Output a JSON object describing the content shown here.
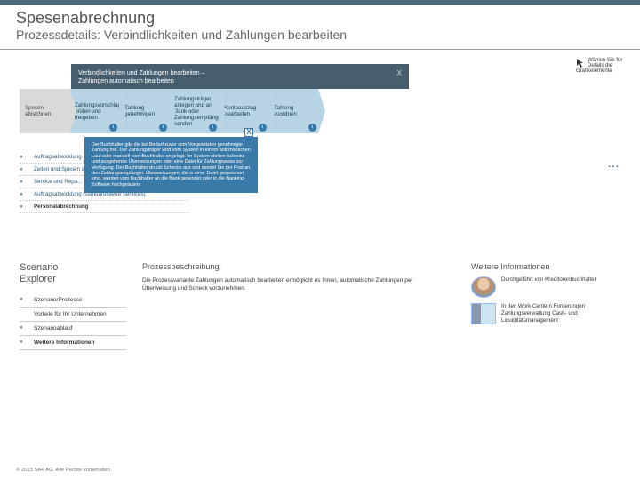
{
  "header": {
    "title": "Spesenabrechnung",
    "subtitle": "Prozessdetails: Verbindlichkeiten und Zahlungen bearbeiten"
  },
  "hint": "Wählen Sie für Details die Grafikelemente",
  "flow": {
    "panel_title_l1": "Verbindlichkeiten und Zahlungen bearbeiten –",
    "panel_title_l2": "Zahlungen automatisch bearbeiten",
    "close": "X",
    "steps": [
      "Spesen abrechnen",
      "Zahlungsvorschlag prüfen und freigeben",
      "Zahlung genehmigen",
      "Zahlungsträger anlegen und an Bank oder Zahlungsempfänger senden",
      "Kontoauszug bearbeiten",
      "Zahlung zuordnen"
    ]
  },
  "tooltip": {
    "close": "X",
    "text": "Der Buchhalter gibt die bei Bedarf zuvor vom Vorgesetzten genehmigte Zahlung frei. Der Zahlungsträger wird vom System in einem automatischen Lauf oder manuell vom Buchhalter angelegt. Im System stehen Schecks und ausgehende Überweisungen oder eine Datei für Zahlungsavise zur Verfügung. Der Buchhalter druckt Schecks aus und sendet Sie per Post an den Zahlungsempfänger. Überweisungen, die in einer Datei gespeichert sind, werden vom Buchhalter an die Bank gesendet oder in die Banking-Software hochgeladen."
  },
  "side_items": [
    "Auftragsabwicklung",
    "Zeiten und Spesen an Unternehmen über...",
    "Service und Repa...",
    "Auftragsabwicklung (standardisierte Services)",
    "Personalabrechnung"
  ],
  "ellipsis": "…",
  "explorer": {
    "l1": "Scenario",
    "l2": "Explorer"
  },
  "left_nav": [
    "Szenario/Prozesse",
    "Vorteile für Ihr Unternehmen",
    "Szenarioablauf",
    "Weitere Informationen"
  ],
  "description": {
    "heading": "Prozessbeschreibung:",
    "text": "Die Prozessvariante Zahlungen automatisch bearbeiten ermöglicht es Ihnen, automatische Zahlungen per Überweisung und Scheck vorzunehmen."
  },
  "further": {
    "heading": "Weitere Informationen",
    "row1": "Durchgeführt von Kreditorenbuchhalter",
    "row2": "In den Work Centern Forderungen Zahlungsverwaltung Cash- und Liquiditätsmanagement"
  },
  "copyright": "© 2013 SAP AG. Alle Rechte vorbehalten."
}
